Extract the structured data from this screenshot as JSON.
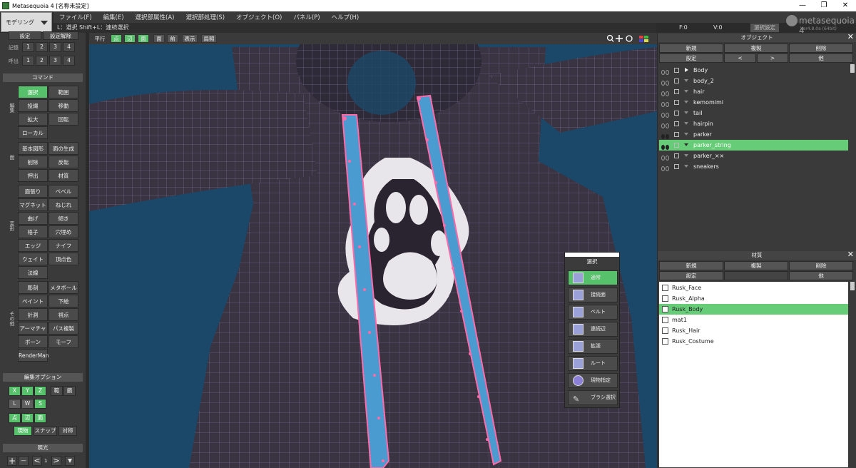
{
  "window": {
    "title": "Metasequoia 4 [名称未設定]",
    "min": "—",
    "max": "❐",
    "close": "✕"
  },
  "mode": {
    "label": "モデリング"
  },
  "menu": [
    "ファイル(F)",
    "編集(E)",
    "選択部属性(A)",
    "選択部処理(S)",
    "オブジェクト(O)",
    "パネル(P)",
    "ヘルプ(H)"
  ],
  "hint": "L：選択 Shift+L：連続選択",
  "status": {
    "f": "F:0",
    "v": "V:0"
  },
  "logo": {
    "brand": "metasequoia 4",
    "version": "Ver4.8.0a (64bit)"
  },
  "selset_btn": "選択設定",
  "left": {
    "selset": {
      "set": "設定",
      "reset": "設定解除"
    },
    "memory": {
      "label": "記憶",
      "items": [
        "1",
        "2",
        "3",
        "4"
      ]
    },
    "recall": {
      "label": "呼出",
      "items": [
        "1",
        "2",
        "3",
        "4"
      ]
    },
    "command_title": "コマンド",
    "groups": [
      "編集",
      "面",
      "変形",
      "その他"
    ],
    "commands": [
      [
        "選択",
        "範囲"
      ],
      [
        "投縄",
        "移動"
      ],
      [
        "拡大",
        "回転"
      ],
      [
        "ローカル",
        ""
      ],
      [
        "基本図形",
        "面の生成"
      ],
      [
        "削除",
        "反転"
      ],
      [
        "押出",
        "材質"
      ],
      [
        "面張り",
        "ベベル"
      ],
      [
        "マグネット",
        "ねじれ"
      ],
      [
        "曲げ",
        "傾き"
      ],
      [
        "格子",
        "穴埋め"
      ],
      [
        "エッジ",
        "ナイフ"
      ],
      [
        "ウェイト",
        "頂点色"
      ],
      [
        "法線",
        ""
      ],
      [
        "彫刻",
        "メタボール"
      ],
      [
        "ペイント",
        "下絵"
      ],
      [
        "計測",
        "視点"
      ],
      [
        "アーマチャー",
        "パス複製"
      ],
      [
        "ボーン",
        "モーフ"
      ],
      [
        "RenderMan",
        ""
      ]
    ],
    "edit_opt_title": "編集オプション",
    "axes": [
      "X",
      "Y",
      "Z"
    ],
    "edit_opt_extra": [
      "範",
      "鏡"
    ],
    "coords": [
      "L",
      "W",
      "S"
    ],
    "pev": [
      "点",
      "辺",
      "面"
    ],
    "snap": [
      "現物",
      "スナップ",
      "対称"
    ],
    "light_title": "照光",
    "light_ctrl": [
      "+",
      "—",
      "<",
      "1",
      ">",
      "▼"
    ]
  },
  "viewport_tb": {
    "items": [
      "平行",
      "点",
      "辺",
      "面",
      "面",
      "前",
      "表示",
      "局照"
    ]
  },
  "popup": {
    "title": "選択",
    "items": [
      "通常",
      "接続面",
      "ベルト",
      "連続辺",
      "拡張",
      "ルート",
      "現物指定",
      "ブラシ選択"
    ]
  },
  "objects": {
    "title": "オブジェクト",
    "buttons": [
      "新規",
      "複製",
      "削除",
      "設定",
      "<",
      ">",
      "他"
    ],
    "items": [
      {
        "name": "Body",
        "expanded": false,
        "eye": false
      },
      {
        "name": "body_2",
        "expanded": true,
        "eye": false
      },
      {
        "name": "hair",
        "expanded": true,
        "eye": false
      },
      {
        "name": "kemomimi",
        "expanded": true,
        "eye": false
      },
      {
        "name": "tail",
        "expanded": true,
        "eye": false
      },
      {
        "name": "hairpin",
        "expanded": true,
        "eye": false
      },
      {
        "name": "parker",
        "expanded": true,
        "eye": true
      },
      {
        "name": "parker_string",
        "expanded": true,
        "eye": true,
        "selected": true
      },
      {
        "name": "parker_××",
        "expanded": true,
        "eye": false
      },
      {
        "name": "sneakers",
        "expanded": true,
        "eye": false
      }
    ]
  },
  "materials": {
    "title": "材質",
    "buttons": [
      "新規",
      "複製",
      "削除",
      "設定",
      "",
      "他"
    ],
    "items": [
      {
        "name": "Rusk_Face"
      },
      {
        "name": "Rusk_Alpha"
      },
      {
        "name": "Rusk_Body",
        "selected": true
      },
      {
        "name": "mat1"
      },
      {
        "name": "Rusk_Hair"
      },
      {
        "name": "Rusk_Costume"
      }
    ]
  },
  "colors": {
    "accent": "#57c06a",
    "viewport_bg": "#1b4869",
    "mesh": "#3a3342",
    "strap": "#4a9bd0",
    "vertex": "#ff6aa8"
  }
}
